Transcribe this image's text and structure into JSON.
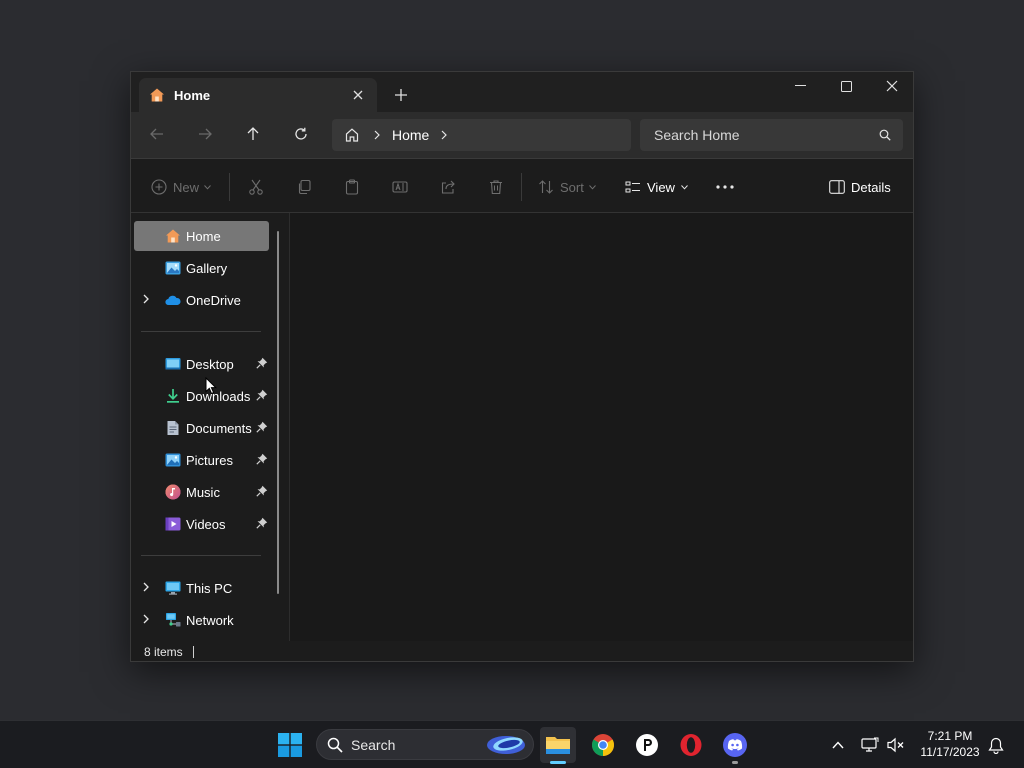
{
  "window": {
    "tab_title": "Home",
    "breadcrumb": [
      "Home"
    ],
    "search_placeholder": "Search Home"
  },
  "toolbar": {
    "new_label": "New",
    "sort_label": "Sort",
    "view_label": "View",
    "details_label": "Details"
  },
  "nav": {
    "top_items": [
      {
        "label": "Home",
        "icon": "home-icon",
        "selected": true
      },
      {
        "label": "Gallery",
        "icon": "gallery-icon"
      },
      {
        "label": "OneDrive",
        "icon": "onedrive-icon",
        "expandable": true
      }
    ],
    "pinned_items": [
      {
        "label": "Desktop",
        "icon": "desktop-icon",
        "pinned": true
      },
      {
        "label": "Downloads",
        "icon": "downloads-icon",
        "pinned": true
      },
      {
        "label": "Documents",
        "icon": "documents-icon",
        "pinned": true
      },
      {
        "label": "Pictures",
        "icon": "pictures-icon",
        "pinned": true
      },
      {
        "label": "Music",
        "icon": "music-icon",
        "pinned": true
      },
      {
        "label": "Videos",
        "icon": "videos-icon",
        "pinned": true
      }
    ],
    "drive_items": [
      {
        "label": "This PC",
        "icon": "this-pc-icon",
        "expandable": true
      },
      {
        "label": "Network",
        "icon": "network-icon",
        "expandable": true
      }
    ]
  },
  "status": {
    "item_count": "8 items"
  },
  "taskbar": {
    "search_label": "Search",
    "apps": [
      "file-explorer-icon",
      "chrome-icon",
      "pocket-app-icon",
      "opera-icon",
      "discord-icon"
    ],
    "time": "7:21 PM",
    "date": "11/17/2023"
  },
  "colors": {
    "desktop_bg": "#2b2c30",
    "window_bg": "#1c1c1c",
    "nav_selected": "#777777",
    "accent": "#60cdff"
  }
}
